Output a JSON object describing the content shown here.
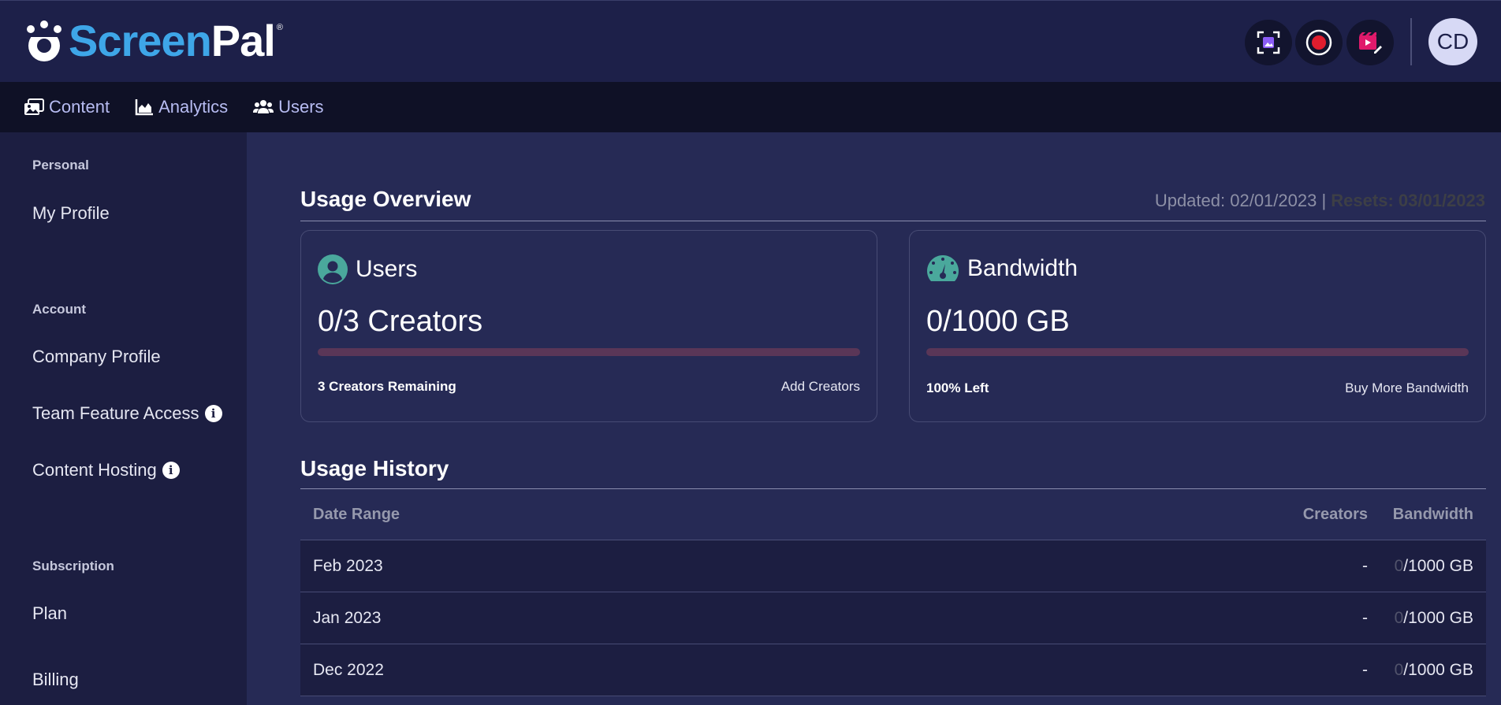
{
  "brand": {
    "screen": "Screen",
    "pal": "Pal",
    "reg": "®"
  },
  "header": {
    "avatar_initials": "CD"
  },
  "nav": [
    {
      "label": "Content",
      "icon": "images-icon"
    },
    {
      "label": "Analytics",
      "icon": "chart-area-icon"
    },
    {
      "label": "Users",
      "icon": "users-icon"
    }
  ],
  "sidebar": {
    "personal": {
      "title": "Personal",
      "items": [
        "My Profile"
      ]
    },
    "account": {
      "title": "Account",
      "items": [
        "Company Profile",
        "Team Feature Access",
        "Content Hosting"
      ]
    },
    "subscription": {
      "title": "Subscription",
      "items": [
        "Plan",
        "Billing"
      ]
    }
  },
  "overview": {
    "title": "Usage Overview",
    "updated": "Updated: 02/01/2023 |",
    "resets": "Resets: 03/01/2023"
  },
  "users_card": {
    "label": "Users",
    "value": "0/3 Creators",
    "progress": 0,
    "remaining": "3 Creators Remaining",
    "action": "Add Creators"
  },
  "bandwidth_card": {
    "label": "Bandwidth",
    "value": "0/1000 GB",
    "progress": 0,
    "remaining": "100% Left",
    "action": "Buy More Bandwidth"
  },
  "history": {
    "title": "Usage History",
    "columns": [
      "Date Range",
      "Creators",
      "Bandwidth"
    ],
    "rows": [
      {
        "date": "Feb 2023",
        "creators": "-",
        "bw_used": "0",
        "bw_total": "/1000 GB"
      },
      {
        "date": "Jan 2023",
        "creators": "-",
        "bw_used": "0",
        "bw_total": "/1000 GB"
      },
      {
        "date": "Dec 2022",
        "creators": "-",
        "bw_used": "0",
        "bw_total": "/1000 GB"
      }
    ]
  },
  "colors": {
    "header_bg": "#1d2049",
    "nav_bg": "#0f1126",
    "sidebar_bg": "#1c1e41",
    "main_bg": "#262a55",
    "brand_blue": "#3ea6e8",
    "nav_text": "#b7bcf2",
    "teal_icon": "#4aa89c",
    "progress_track": "#5a3657"
  }
}
